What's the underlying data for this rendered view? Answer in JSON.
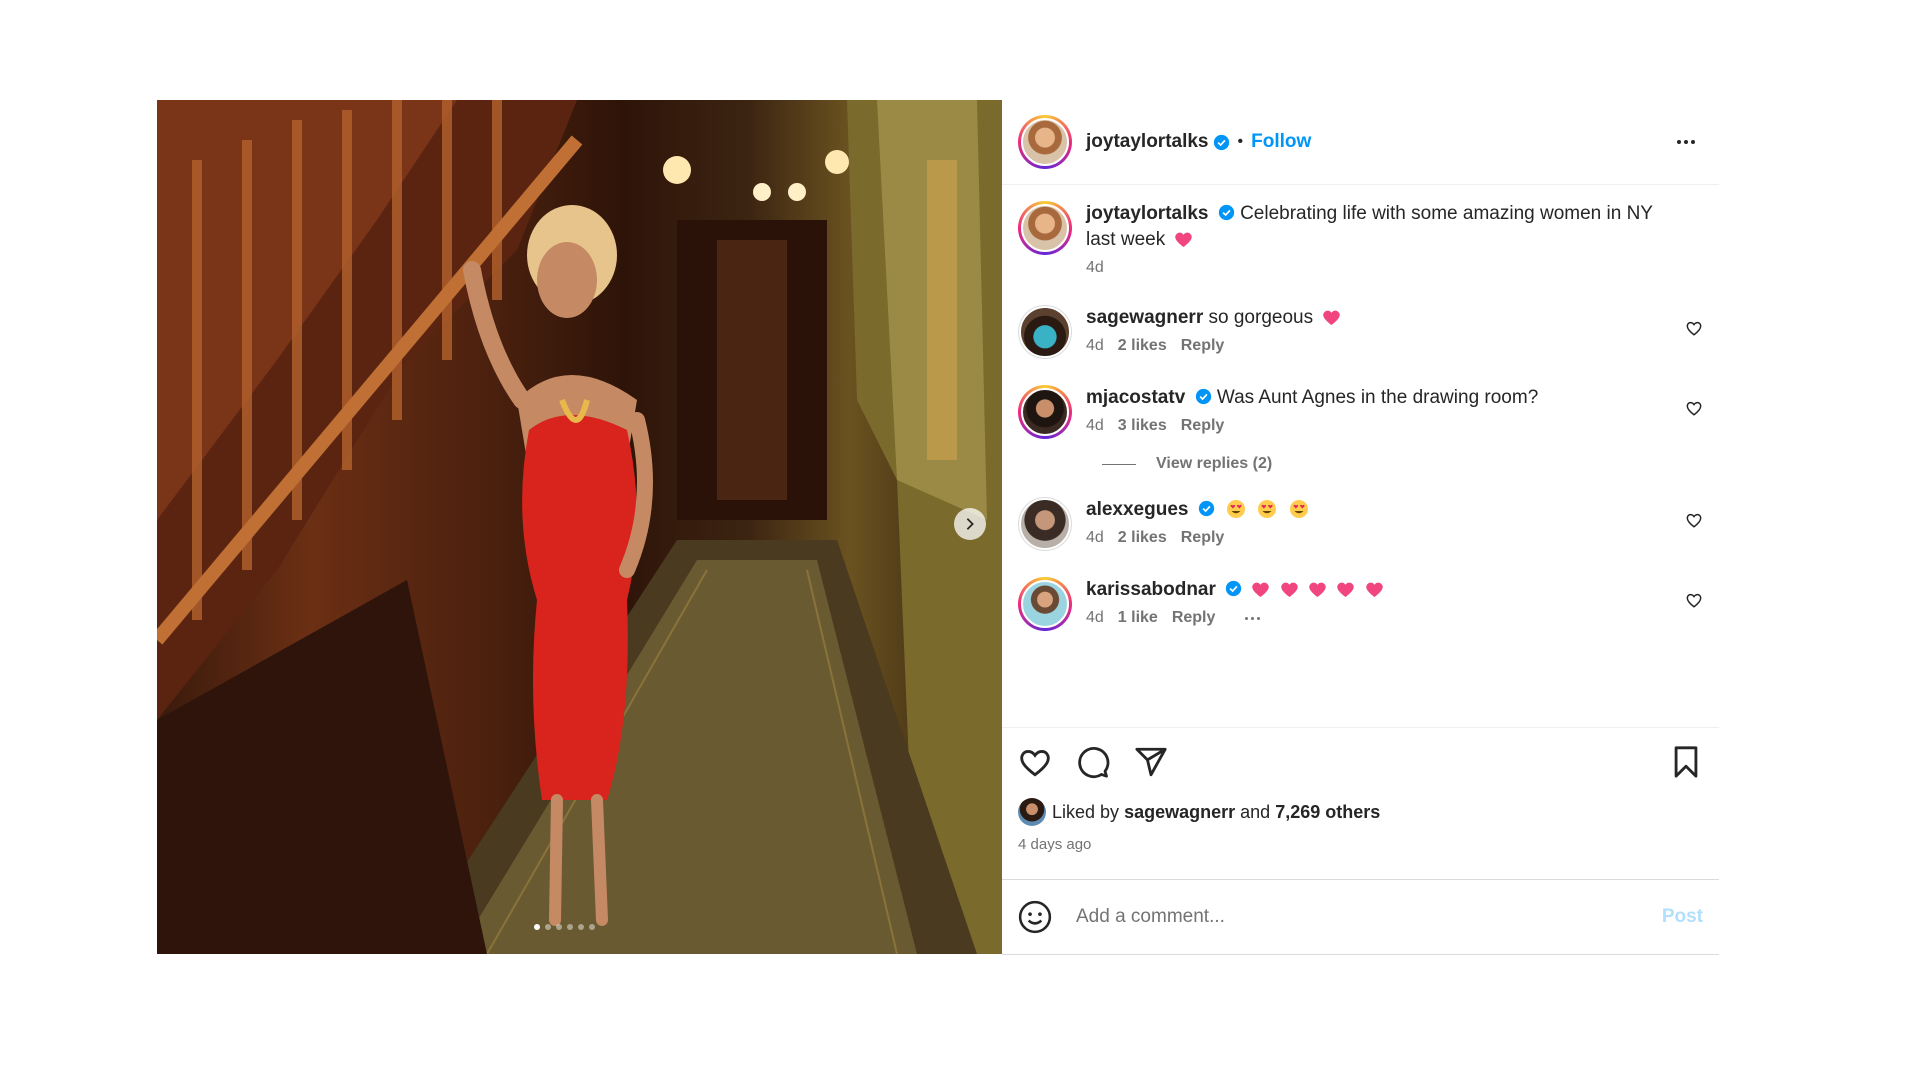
{
  "header": {
    "username": "joytaylortalks",
    "separator": "•",
    "follow_label": "Follow"
  },
  "caption": {
    "username": "joytaylortalks",
    "text": "Celebrating life with some amazing women in NY last week",
    "time": "4d"
  },
  "comments": [
    {
      "username": "sagewagnerr",
      "text": "so gorgeous",
      "time": "4d",
      "likes": "2 likes",
      "reply": "Reply",
      "verified": false
    },
    {
      "username": "mjacostatv",
      "text": "Was Aunt Agnes in the drawing room?",
      "time": "4d",
      "likes": "3 likes",
      "reply": "Reply",
      "verified": true
    },
    {
      "username": "alexxegues",
      "text": "",
      "time": "4d",
      "likes": "2 likes",
      "reply": "Reply",
      "verified": true
    },
    {
      "username": "karissabodnar",
      "text": "",
      "time": "4d",
      "likes": "1 like",
      "reply": "Reply",
      "verified": true
    }
  ],
  "view_replies": "View replies (2)",
  "likes_summary": {
    "prefix": "Liked by",
    "user": "sagewagnerr",
    "and": "and",
    "others": "7,269 others"
  },
  "posted_ago": "4 days ago",
  "add_comment": {
    "placeholder": "Add a comment...",
    "post_label": "Post"
  },
  "carousel": {
    "total": 6,
    "active_index": 0
  },
  "colors": {
    "accent": "#0095f6",
    "heart": "#f0457f",
    "verified": "#0095f6",
    "post_disabled": "#b2dffc"
  },
  "icons": [
    "heart-icon",
    "comment-icon",
    "share-icon",
    "bookmark-icon",
    "emoji-icon",
    "more-icon",
    "chevron-right-icon",
    "verified-icon"
  ]
}
